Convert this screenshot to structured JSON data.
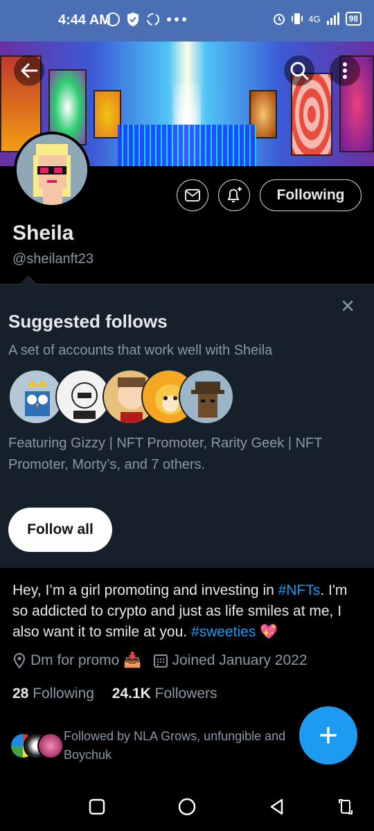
{
  "status_bar": {
    "time": "4:44 AM",
    "network": "4G",
    "battery": "98"
  },
  "profile": {
    "name": "Sheila",
    "handle": "@sheilanft23",
    "following_button": "Following"
  },
  "suggested": {
    "title": "Suggested follows",
    "subtitle": "A set of accounts that work well with Sheila",
    "featuring": "Featuring Gizzy | NFT Promoter, Rarity Geek | NFT Promoter, Morty’s, and 7 others.",
    "follow_all": "Follow all",
    "close_icon": "×"
  },
  "bio": {
    "part1": "Hey, I’m a girl promoting and investing in ",
    "tag1": "#NFTs",
    "part2": ". I'm so addicted to crypto and just as life smiles at me, I also want it to smile at you. ",
    "tag2": "#sweeties",
    "emoji": "💖"
  },
  "meta": {
    "location": "Dm for promo",
    "location_emoji": "📥",
    "joined": "Joined January 2022"
  },
  "counts": {
    "following_num": "28",
    "following_label": "Following",
    "followers_num": "24.1K",
    "followers_label": "Followers"
  },
  "followed_by": {
    "text": "Followed by NLA Grows, unfungible and",
    "text2": "Boychuk"
  },
  "fab": {
    "label": "+"
  },
  "colors": {
    "accent": "#1d9bf0",
    "status_bar": "#4a6fb5",
    "panel": "#16202a"
  }
}
